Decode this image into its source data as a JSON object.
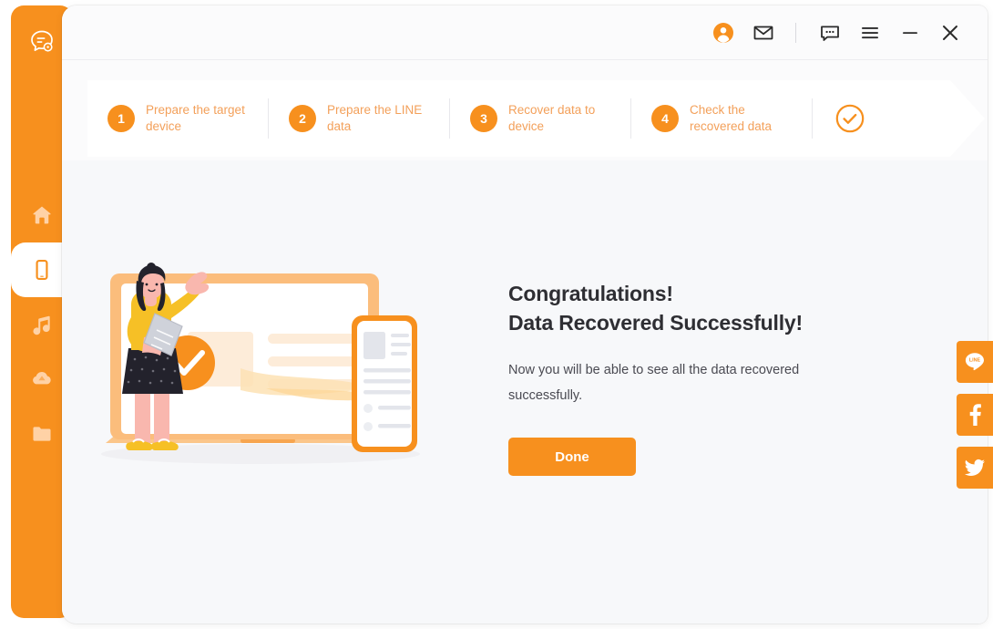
{
  "app": {
    "logo_icon": "chat-bubble-logo-icon",
    "accent_color": "#f7901e",
    "content_bg": "#f7f8fa"
  },
  "titlebar": {
    "icons": [
      {
        "name": "account-avatar-icon",
        "label": "Account"
      },
      {
        "name": "mail-icon",
        "label": "Mail"
      },
      {
        "name": "feedback-chat-icon",
        "label": "Feedback"
      },
      {
        "name": "menu-hamburger-icon",
        "label": "Menu"
      },
      {
        "name": "minimize-icon",
        "label": "Minimize"
      },
      {
        "name": "close-icon",
        "label": "Close"
      }
    ]
  },
  "sidebar": {
    "items": [
      {
        "name": "home",
        "icon": "home-icon",
        "active": false
      },
      {
        "name": "device",
        "icon": "phone-device-icon",
        "active": true
      },
      {
        "name": "music",
        "icon": "music-note-icon",
        "active": false
      },
      {
        "name": "cloud",
        "icon": "cloud-drive-icon",
        "active": false
      },
      {
        "name": "files",
        "icon": "folder-icon",
        "active": false
      }
    ]
  },
  "steps": [
    {
      "number": "1",
      "label": "Prepare the target device"
    },
    {
      "number": "2",
      "label": "Prepare the LINE data"
    },
    {
      "number": "3",
      "label": "Recover data to device"
    },
    {
      "number": "4",
      "label": "Check the recovered data"
    }
  ],
  "step_complete_icon": "check-circle-icon",
  "main": {
    "headline_line1": "Congratulations!",
    "headline_line2": "Data Recovered Successfully!",
    "subtext": "Now you will be able to see all the data recovered successfully.",
    "done_label": "Done",
    "illustration_name": "data-recovered-laptop-phone-illustration"
  },
  "social": [
    {
      "name": "line-share-button",
      "icon": "line-icon",
      "label": "LINE"
    },
    {
      "name": "facebook-share-button",
      "icon": "facebook-icon",
      "label": "f"
    },
    {
      "name": "twitter-share-button",
      "icon": "twitter-icon",
      "label": "Twitter"
    }
  ]
}
